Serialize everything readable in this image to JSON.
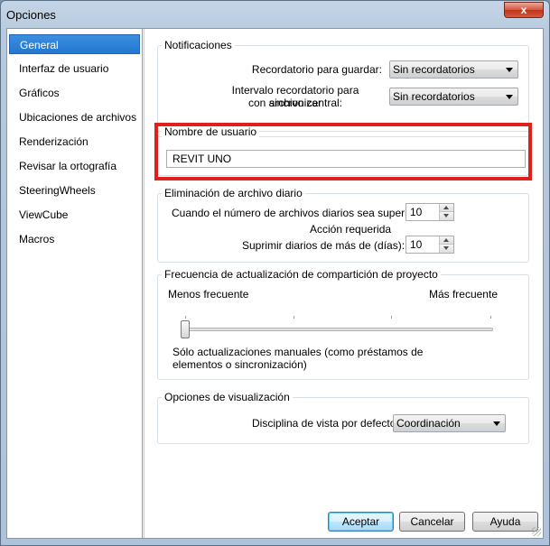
{
  "window": {
    "title": "Opciones",
    "close_label": "x"
  },
  "sidebar": {
    "items": [
      {
        "label": "General",
        "selected": true
      },
      {
        "label": "Interfaz de usuario"
      },
      {
        "label": "Gráficos"
      },
      {
        "label": "Ubicaciones de archivos"
      },
      {
        "label": "Renderización"
      },
      {
        "label": "Revisar la ortografía"
      },
      {
        "label": "SteeringWheels"
      },
      {
        "label": "ViewCube"
      },
      {
        "label": "Macros"
      }
    ]
  },
  "notificaciones": {
    "title": "Notificaciones",
    "save_reminder_label": "Recordatorio para guardar:",
    "save_reminder_value": "Sin recordatorios",
    "sync_reminder_label_line1": "Intervalo recordatorio para sincronizar",
    "sync_reminder_label_line2": "con archivo central:",
    "sync_reminder_value": "Sin recordatorios"
  },
  "usuario": {
    "title": "Nombre de usuario",
    "value": "REVIT  UNO"
  },
  "eliminacion": {
    "title": "Eliminación de archivo diario",
    "count_label": "Cuando el número de archivos diarios sea superior a:",
    "count_value": "10",
    "action_label": "Acción requerida",
    "days_label": "Suprimir diarios de más de (días):",
    "days_value": "10"
  },
  "frecuencia": {
    "title": "Frecuencia de actualización de compartición de proyecto",
    "less_label": "Menos frecuente",
    "more_label": "Más frecuente",
    "slider_level": 0,
    "description": "Sólo actualizaciones manuales (como préstamos de elementos o sincronización)"
  },
  "visualizacion": {
    "title": "Opciones de visualización",
    "discipline_label": "Disciplina de vista por defecto:",
    "discipline_value": "Coordinación"
  },
  "buttons": {
    "accept": "Aceptar",
    "cancel": "Cancelar",
    "help": "Ayuda"
  },
  "colors": {
    "selection": "#2a7fd6",
    "highlight_border": "#e0201a",
    "close_button": "#d04a2e"
  }
}
